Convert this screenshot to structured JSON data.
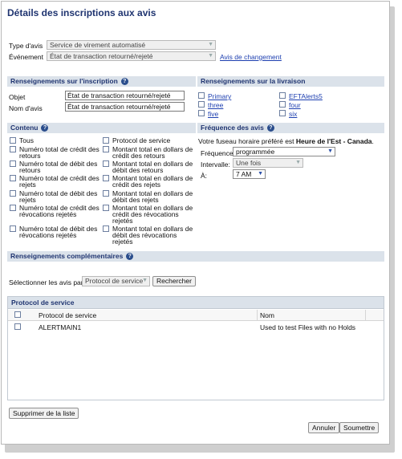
{
  "page": {
    "title": "Détails des inscriptions aux avis"
  },
  "top": {
    "type_label": "Type d'avis",
    "type_value": "Service de virement automatisé",
    "event_label": "Événement",
    "event_value": "État de transaction retourné/rejeté",
    "change_link": "Avis de changement"
  },
  "subscription": {
    "header": "Renseignements sur l'inscription",
    "subject_label": "Objet",
    "subject_value": "État de transaction retourné/rejeté",
    "name_label": "Nom d'avis",
    "name_value": "État de transaction retourné/rejeté"
  },
  "delivery": {
    "header": "Renseignements sur la livraison",
    "col1": [
      "Primary",
      "three",
      "five"
    ],
    "col2": [
      "EFTAlerts5",
      "four",
      "six"
    ]
  },
  "content": {
    "header": "Contenu",
    "col1": [
      [
        "Tous"
      ],
      [
        "Numéro total de crédit des",
        "retours"
      ],
      [
        "Numéro total de débit des",
        "retours"
      ],
      [
        "Numéro total de crédit des",
        "rejets"
      ],
      [
        "Numéro total de débit des",
        "rejets"
      ],
      [
        "Numéro total de crédit des",
        "révocations rejetés"
      ],
      [
        "Numéro total de débit des",
        "révocations rejetés"
      ]
    ],
    "col2": [
      [
        "Protocol de service"
      ],
      [
        "Montant total en dollars de",
        "crédit des retours"
      ],
      [
        "Montant total en dollars de",
        "débit des retours"
      ],
      [
        "Montant total en dollars de",
        "crédit des rejets"
      ],
      [
        "Montant total en dollars de",
        "débit des rejets"
      ],
      [
        "Montant total en dollars de",
        "crédit des révocations",
        "rejetés"
      ],
      [
        "Montant total en dollars de",
        "débit des révocations",
        "rejetés"
      ]
    ]
  },
  "frequency": {
    "header": "Fréquence des avis",
    "tz_prefix": "Votre fuseau horaire préféré est ",
    "tz_value": "Heure de l'Est - Canada",
    "tz_suffix": ".",
    "freq_label": "Fréquence",
    "freq_value": "programmée",
    "interval_label": "Intervalle:",
    "interval_value": "Une fois",
    "at_label": "À:",
    "at_value": "7 AM"
  },
  "additional": {
    "header": "Renseignements complémentaires"
  },
  "search": {
    "label": "Sélectionner les avis par:",
    "value": "Protocol de service",
    "button": "Rechercher"
  },
  "results": {
    "header": "Protocol de service",
    "col_protocol": "Protocol de service",
    "col_name": "Nom",
    "rows": [
      {
        "protocol": "ALERTMAIN1",
        "name": "Used to test Files with no Holds"
      }
    ]
  },
  "actions": {
    "remove": "Supprimer de la liste",
    "cancel": "Annuler",
    "submit": "Soumettre"
  }
}
